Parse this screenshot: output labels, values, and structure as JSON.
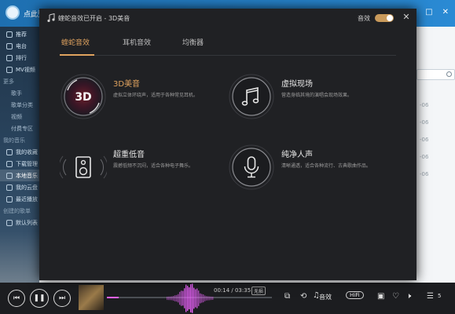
{
  "app": {
    "title": "点此登",
    "sidebar": {
      "items": [
        {
          "label": "推荐",
          "type": "item"
        },
        {
          "label": "电台",
          "type": "item"
        },
        {
          "label": "排行",
          "type": "item"
        },
        {
          "label": "MV视频",
          "type": "item"
        },
        {
          "label": "更多",
          "type": "section"
        },
        {
          "label": "歌手",
          "type": "sub"
        },
        {
          "label": "歌单分类",
          "type": "sub"
        },
        {
          "label": "视频",
          "type": "sub"
        },
        {
          "label": "付费专区",
          "type": "sub"
        },
        {
          "label": "我的音乐",
          "type": "section"
        },
        {
          "label": "我的收藏",
          "type": "item"
        },
        {
          "label": "下载管理",
          "type": "item"
        },
        {
          "label": "本地音乐",
          "type": "item",
          "active": true
        },
        {
          "label": "我的云盘",
          "type": "item"
        },
        {
          "label": "最近播放",
          "type": "item"
        },
        {
          "label": "创建的歌单",
          "type": "section"
        },
        {
          "label": "默认列表",
          "type": "item"
        }
      ]
    },
    "content_dates": [
      "-06",
      "-06",
      "-06",
      "-06",
      "-06"
    ]
  },
  "dialog": {
    "title": "蝰蛇音效已开启 - 3D美音",
    "sound_label": "音效",
    "sound_enabled": true,
    "tabs": [
      {
        "label": "蝰蛇音效",
        "active": true
      },
      {
        "label": "耳机音效",
        "active": false
      },
      {
        "label": "均衡器",
        "active": false
      }
    ],
    "effects": [
      {
        "name": "3D美音",
        "desc": "虚拟立体环绕声，适用于各种常见耳机。",
        "icon": "3d-icon",
        "icon_text": "3D",
        "active": true
      },
      {
        "name": "虚拟现场",
        "desc": "营造身临其境的演唱会现场效果。",
        "icon": "music-note-icon",
        "active": false
      },
      {
        "name": "超重低音",
        "desc": "震撼低频不沉闷，适合各种电子舞乐。",
        "icon": "speaker-icon",
        "active": false
      },
      {
        "name": "纯净人声",
        "desc": "清晰通透，适合各种流行、古典歌曲作品。",
        "icon": "microphone-icon",
        "active": false
      }
    ]
  },
  "player": {
    "time_current": "00:14",
    "time_total": "03:35",
    "time_text": "00:14 / 03:35",
    "quality": "无损",
    "progress": 0.07,
    "sound_fx_label": "音效",
    "hifi_label": "HiFi",
    "playlist_count": "5",
    "accent": "#ee62ff"
  },
  "colors": {
    "accent": "#e0a35f",
    "dialog_bg": "#202124",
    "topbar": "#2a8ad4"
  }
}
